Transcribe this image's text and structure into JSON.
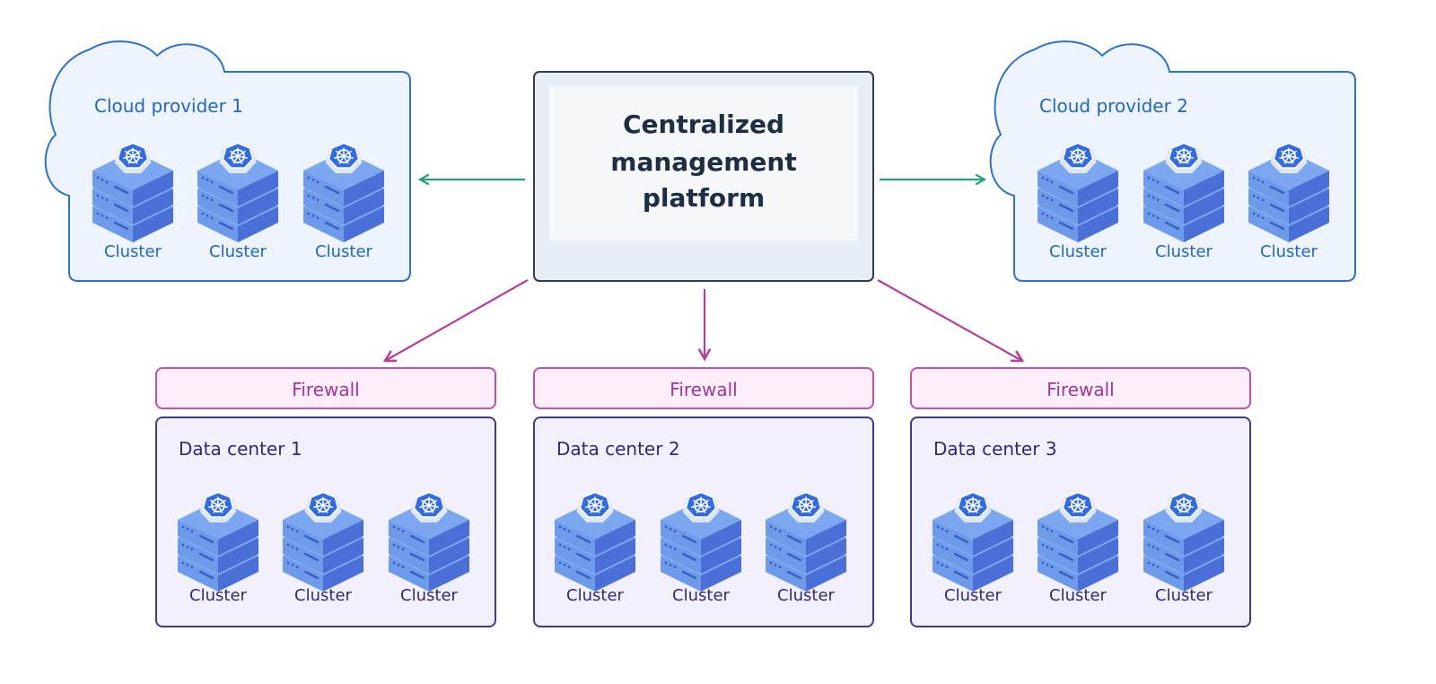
{
  "colors": {
    "cloud_stroke": "#2f72c9",
    "cloud_fill": "#edf4fd",
    "cloud_text": "#2167c2",
    "platform_stroke": "#2d3e50",
    "platform_fill": "#e6edf5",
    "platform_inner": "#f5f8fa",
    "platform_text": "#1f2d44",
    "cloud_arrow": "#2a9d7f",
    "dc_arrow": "#b0409a",
    "firewall_fill": "#fdeefa",
    "firewall_stroke": "#c053a8",
    "firewall_text": "#a0359a",
    "dc_fill": "#f1f0fc",
    "dc_stroke": "#3f3a8a",
    "dc_text": "#2e2a7a"
  },
  "platform": {
    "lines": [
      "Centralized",
      "management",
      "platform"
    ]
  },
  "clouds": [
    {
      "label": "Cloud provider 1",
      "clusters": [
        "Cluster",
        "Cluster",
        "Cluster"
      ],
      "icon": "kubernetes-server-stack-icon"
    },
    {
      "label": "Cloud provider 2",
      "clusters": [
        "Cluster",
        "Cluster",
        "Cluster"
      ],
      "icon": "kubernetes-server-stack-icon"
    }
  ],
  "data_centers": [
    {
      "firewall": "Firewall",
      "label": "Data center 1",
      "clusters": [
        "Cluster",
        "Cluster",
        "Cluster"
      ]
    },
    {
      "firewall": "Firewall",
      "label": "Data center 2",
      "clusters": [
        "Cluster",
        "Cluster",
        "Cluster"
      ]
    },
    {
      "firewall": "Firewall",
      "label": "Data center 3",
      "clusters": [
        "Cluster",
        "Cluster",
        "Cluster"
      ]
    }
  ]
}
